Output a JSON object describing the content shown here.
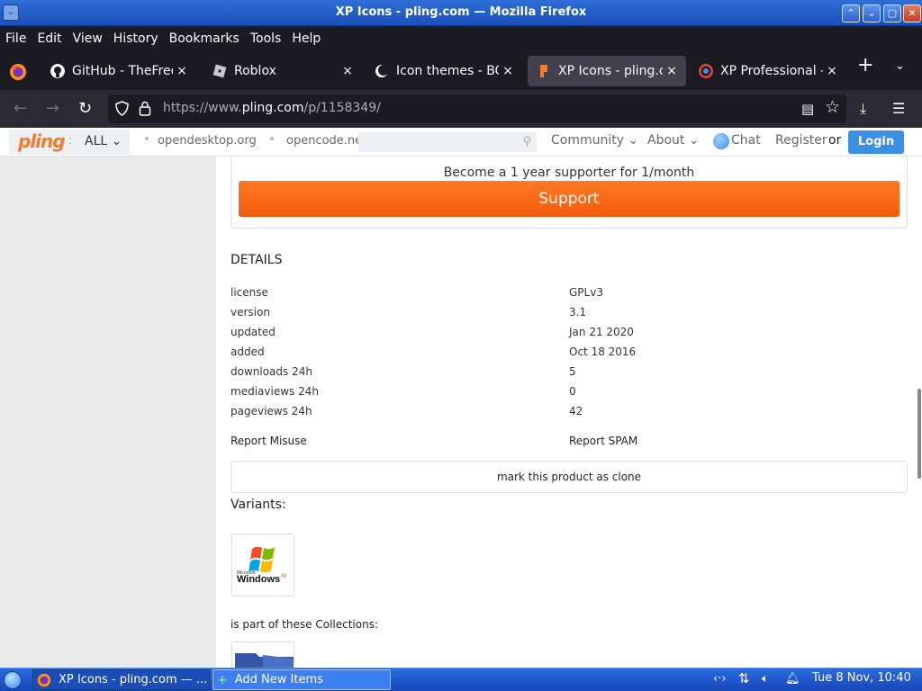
{
  "window": {
    "title": "XP Icons - pling.com — Mozilla Firefox",
    "menu_icon": "chevron-down-icon",
    "controls": [
      "minimize-icon",
      "restore-icon",
      "maximize-icon",
      "close-icon"
    ]
  },
  "menubar": {
    "items": [
      "File",
      "Edit",
      "View",
      "History",
      "Bookmarks",
      "Tools",
      "Help"
    ]
  },
  "tabs": {
    "items": [
      {
        "label": "GitHub - TheFreeP",
        "icon": "github-icon",
        "close": "×",
        "active": false
      },
      {
        "label": "Roblox",
        "icon": "roblox-icon",
        "close": "×",
        "active": false
      },
      {
        "label": "Icon themes - BOO",
        "icon": "moon-icon",
        "close": "×",
        "active": false
      },
      {
        "label": "XP Icons - pling.co",
        "icon": "pling-icon",
        "close": "×",
        "active": true
      },
      {
        "label": "XP Professional - O",
        "icon": "opendesktop-icon",
        "close": "×",
        "active": false
      }
    ],
    "new_tab": "+",
    "list_all": "⌄"
  },
  "navbar": {
    "url_prefix": "https://www.",
    "url_domain": "pling.com",
    "url_path": "/p/1158349/"
  },
  "site": {
    "logo": "pling",
    "logo_colon": ":",
    "all_dropdown": "ALL ⌄",
    "links": [
      "opendesktop.org",
      "opencode.ne"
    ],
    "search_placeholder": "",
    "community": "Community ⌄",
    "about": "About ⌄",
    "chat": "Chat",
    "register": "Register",
    "or": "or",
    "login": "Login"
  },
  "support": {
    "cut_text": "Become a 1 year supporter for 1/month",
    "button": "Support"
  },
  "details": {
    "heading": "DETAILS",
    "rows": [
      {
        "key": "license",
        "value": "GPLv3"
      },
      {
        "key": "version",
        "value": "3.1"
      },
      {
        "key": "updated",
        "value": "Jan 21 2020"
      },
      {
        "key": "added",
        "value": "Oct 18 2016"
      },
      {
        "key": "downloads 24h",
        "value": "5"
      },
      {
        "key": "mediaviews 24h",
        "value": "0"
      },
      {
        "key": "pageviews 24h",
        "value": "42"
      }
    ],
    "report_misuse": "Report Misuse",
    "report_spam": "Report SPAM",
    "clone_button": "mark this product as clone"
  },
  "variants": {
    "heading": "Variants:",
    "thumb_logo": "Windows",
    "thumb_sup": "xp",
    "thumb_small": "Microsoft"
  },
  "collections": {
    "heading": "is part of these Collections:"
  },
  "taskbar": {
    "tasks": [
      {
        "label": "XP Icons - pling.com — ...",
        "icon": "firefox-icon"
      },
      {
        "label": "Add New Items",
        "icon": "plus-icon"
      }
    ],
    "clock": "Tue  8 Nov, 10:40"
  },
  "colors": {
    "accent_orange": "#f15a0e",
    "login_blue": "#3b8fe5",
    "titlebar_blue": "#1a4fb8"
  }
}
